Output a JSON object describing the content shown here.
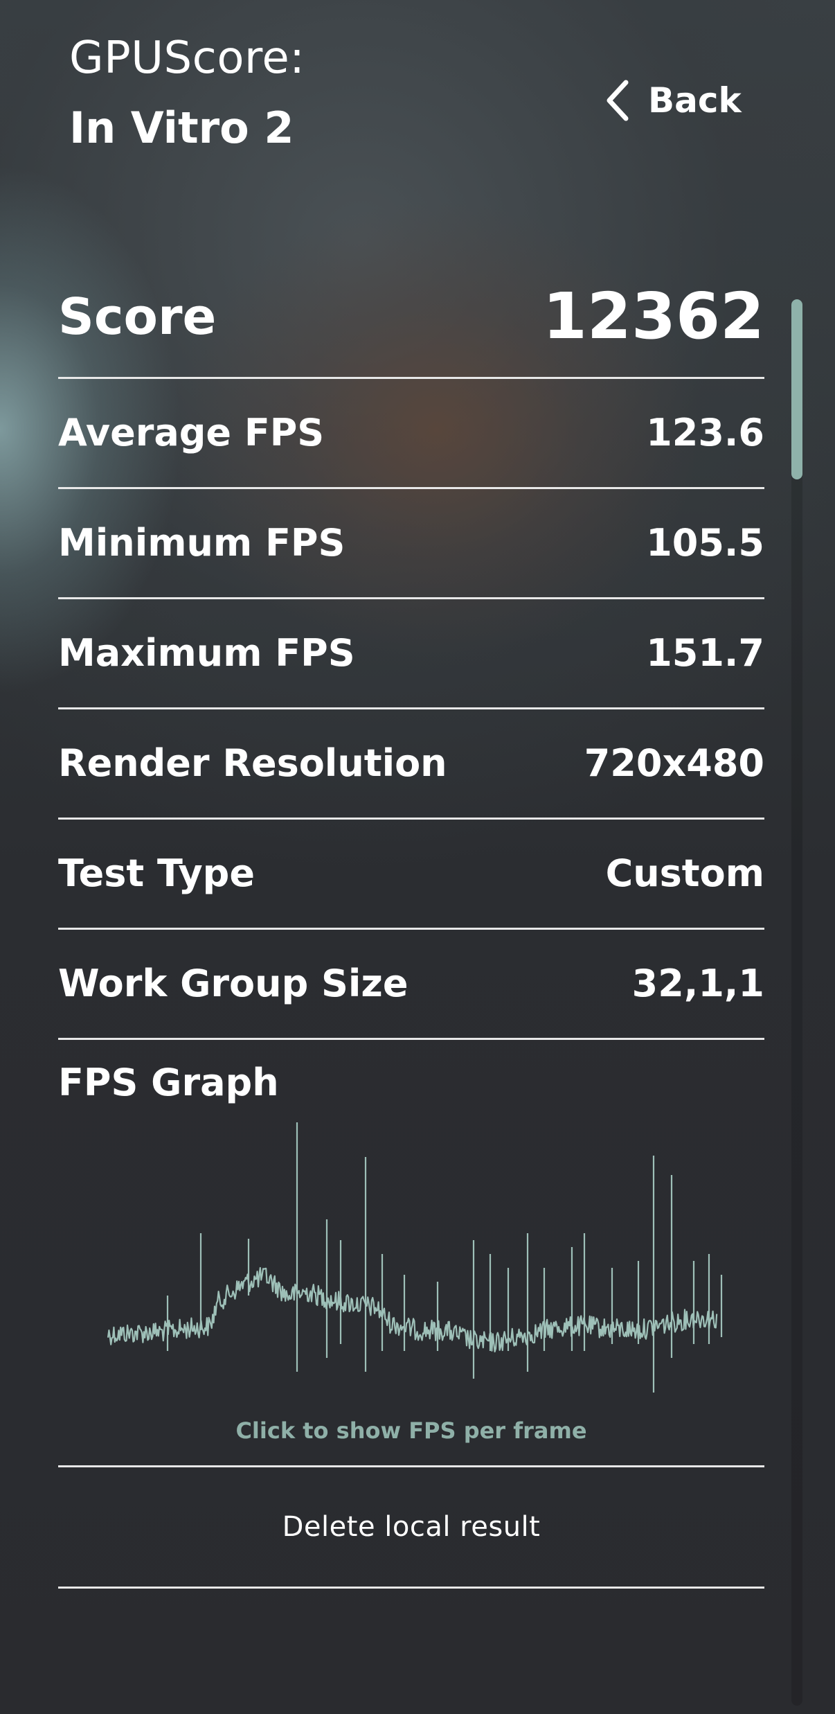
{
  "header": {
    "app_name": "GPUScore:",
    "benchmark_name": "In Vitro 2",
    "back_label": "Back"
  },
  "score": {
    "label": "Score",
    "value": "12362"
  },
  "stats": [
    {
      "label": "Average FPS",
      "value": "123.6"
    },
    {
      "label": "Minimum FPS",
      "value": "105.5"
    },
    {
      "label": "Maximum FPS",
      "value": "151.7"
    },
    {
      "label": "Render Resolution",
      "value": "720x480"
    },
    {
      "label": "Test Type",
      "value": "Custom"
    },
    {
      "label": "Work Group Size",
      "value": "32,1,1"
    }
  ],
  "graph": {
    "title": "FPS Graph",
    "hint": "Click to show FPS per frame",
    "line_color": "#9ec0b8"
  },
  "actions": {
    "delete_label": "Delete local result"
  },
  "colors": {
    "accent": "#8fb2aa",
    "background": "#2a2b2f",
    "divider": "#e8e8e8"
  }
}
